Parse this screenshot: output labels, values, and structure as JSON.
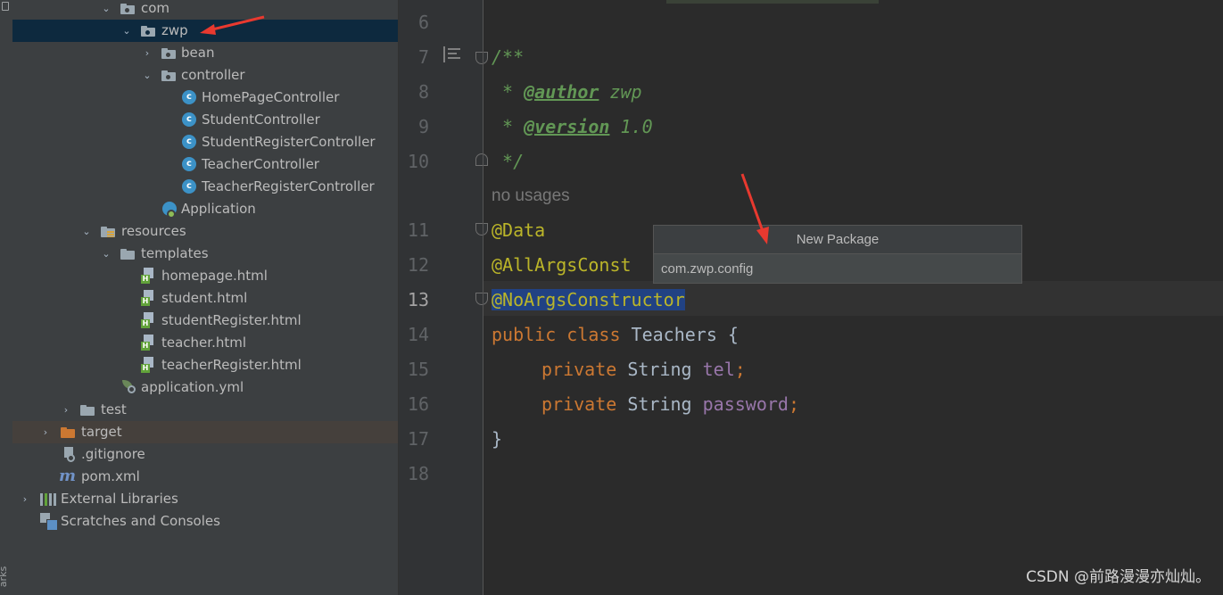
{
  "side_strip": {
    "label": "arks"
  },
  "tree": {
    "items": [
      {
        "label": "com"
      },
      {
        "label": "zwp"
      },
      {
        "label": "bean"
      },
      {
        "label": "controller"
      },
      {
        "label": "HomePageController"
      },
      {
        "label": "StudentController"
      },
      {
        "label": "StudentRegisterController"
      },
      {
        "label": "TeacherController"
      },
      {
        "label": "TeacherRegisterController"
      },
      {
        "label": "Application"
      },
      {
        "label": "resources"
      },
      {
        "label": "templates"
      },
      {
        "label": "homepage.html"
      },
      {
        "label": "student.html"
      },
      {
        "label": "studentRegister.html"
      },
      {
        "label": "teacher.html"
      },
      {
        "label": "teacherRegister.html"
      },
      {
        "label": "application.yml"
      },
      {
        "label": "test"
      },
      {
        "label": "target"
      },
      {
        "label": ".gitignore"
      },
      {
        "label": "pom.xml"
      },
      {
        "label": "External Libraries"
      },
      {
        "label": "Scratches and Consoles"
      }
    ],
    "class_badge": "c",
    "html_badge": "H"
  },
  "editor": {
    "line_numbers": [
      "6",
      "7",
      "8",
      "9",
      "10",
      "11",
      "12",
      "13",
      "14",
      "15",
      "16",
      "17",
      "18"
    ],
    "current_line": "13",
    "no_usages_hint": "no usages",
    "code": {
      "l7": "/**",
      "l8_star": " * ",
      "l8_tag": "@author",
      "l8_rest": " zwp",
      "l9_star": " * ",
      "l9_tag": "@version",
      "l9_rest": " 1.0",
      "l10": " */",
      "l11": "@Data",
      "l12": "@AllArgsConst",
      "l13": "@NoArgsConstructor",
      "l14_kw": "public class",
      "l14_rest": " Teachers {",
      "l15_kw": "private",
      "l15_type": " String ",
      "l15_field": "tel",
      "l15_semi": ";",
      "l16_kw": "private",
      "l16_type": " String ",
      "l16_field": "password",
      "l16_semi": ";",
      "l17": "}"
    }
  },
  "popup": {
    "title": "New Package",
    "input_value": "com.zwp.config"
  },
  "watermark": "CSDN @前路漫漫亦灿灿。",
  "colors": {
    "annotation_arrow": "#e8392f",
    "selection_row": "#0d293e",
    "excluded_row": "#45403c",
    "keyword": "#cc7832",
    "annotation": "#bbb529",
    "doc_comment": "#629755",
    "field": "#9876aa"
  }
}
